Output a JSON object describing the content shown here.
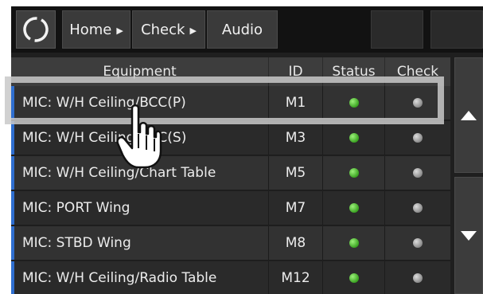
{
  "breadcrumbs": {
    "home": "Home",
    "check": "Check",
    "audio": "Audio"
  },
  "table": {
    "headers": {
      "equipment": "Equipment",
      "id": "ID",
      "status": "Status",
      "check": "Check"
    },
    "rows": [
      {
        "equipment": "MIC: W/H Ceiling/BCC(P)",
        "id": "M1",
        "status": "green",
        "check": "gray"
      },
      {
        "equipment": "MIC: W/H Ceiling/BCC(S)",
        "id": "M3",
        "status": "green",
        "check": "gray"
      },
      {
        "equipment": "MIC: W/H Ceiling/Chart Table",
        "id": "M5",
        "status": "green",
        "check": "gray"
      },
      {
        "equipment": "MIC: PORT Wing",
        "id": "M7",
        "status": "green",
        "check": "gray"
      },
      {
        "equipment": "MIC: STBD Wing",
        "id": "M8",
        "status": "green",
        "check": "gray"
      },
      {
        "equipment": "MIC: W/H Ceiling/Radio Table",
        "id": "M12",
        "status": "green",
        "check": "gray"
      }
    ]
  },
  "colors": {
    "background": "#1f1f1f",
    "accent": "#2f6fd0",
    "status_ok": "#3aa321",
    "check_idle": "#8a8a8a",
    "highlight": "#c9c9c9"
  },
  "icons": {
    "logo": "ring-logo-icon",
    "scroll_up": "triangle-up-icon",
    "scroll_down": "triangle-down-icon",
    "cursor": "hand-pointer-icon"
  }
}
